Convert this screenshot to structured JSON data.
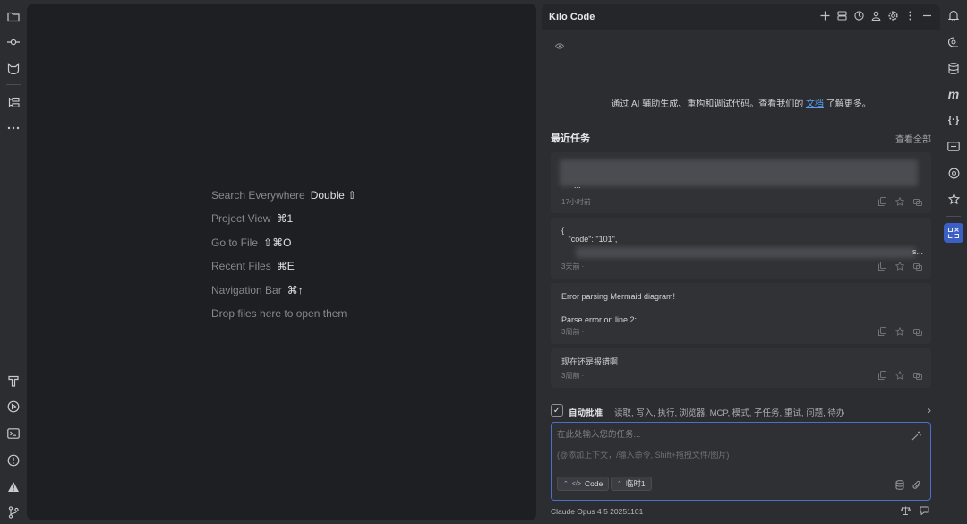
{
  "editor": {
    "hints": [
      {
        "label": "Search Everywhere",
        "key": "Double ⇧"
      },
      {
        "label": "Project View",
        "key": "⌘1"
      },
      {
        "label": "Go to File",
        "key": "⇧⌘O"
      },
      {
        "label": "Recent Files",
        "key": "⌘E"
      },
      {
        "label": "Navigation Bar",
        "key": "⌘↑"
      },
      {
        "label": "Drop files here to open them",
        "key": ""
      }
    ]
  },
  "left_strip": {
    "icons": [
      "folder-icon",
      "commit-icon",
      "kilo-logo-icon",
      "structure-icon",
      "more-icon",
      "text-format-icon",
      "run-icon",
      "terminal-icon",
      "problems-icon",
      "warning-icon",
      "git-branch-icon"
    ]
  },
  "right_strip": {
    "icons": [
      "notifications-icon",
      "ai-chat-icon",
      "database-icon",
      "m-icon",
      "code-braces-icon",
      "devices-icon",
      "target-icon",
      "ai-assistant-icon",
      "kilo-code-icon"
    ]
  },
  "panel": {
    "title": "Kilo Code",
    "intro_prefix": "通过 AI 辅助生成、重构和调试代码。查看我们的",
    "intro_link": "文档",
    "intro_suffix": "了解更多。",
    "recent_title": "最近任务",
    "view_all": "查看全部",
    "tasks": [
      {
        "text": "...",
        "time": "17小时前 ·"
      },
      {
        "text": "{\n   \"code\": \"101\",",
        "time": "3天前 ·",
        "tail": "s..."
      },
      {
        "text": "Error parsing Mermaid diagram!\n\nParse error on line 2:...",
        "time": "3周前 ·"
      },
      {
        "text": "现在还是报错啊",
        "time": "3周前 ·"
      }
    ],
    "auto_approve": {
      "checked": true,
      "label": "自动批准",
      "items": "读取, 写入, 执行, 浏览器, MCP, 模式, 子任务, 重试, 问题, 待办"
    },
    "input": {
      "placeholder": "在此处输入您的任务...",
      "sub_placeholder": "(@添加上下文，/输入命令, Shift+拖拽文件/图片)",
      "mode_chip": "Code",
      "profile_chip": "临时1"
    },
    "model": "Claude Opus 4 5 20251101"
  }
}
